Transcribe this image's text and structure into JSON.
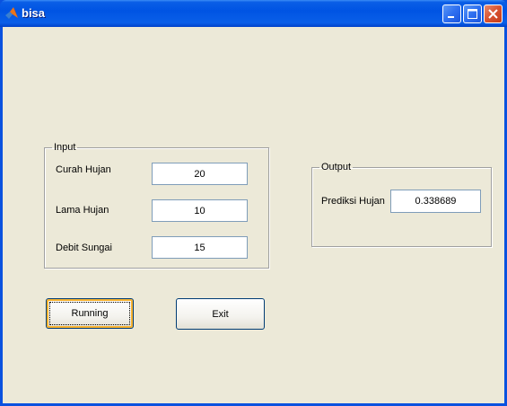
{
  "window": {
    "title": "bisa",
    "icon": "matlab-icon",
    "controls": [
      "minimize-icon",
      "maximize-icon",
      "close-icon"
    ]
  },
  "input_panel": {
    "legend": "Input",
    "fields": [
      {
        "label": "Curah Hujan",
        "value": "20"
      },
      {
        "label": "Lama Hujan",
        "value": "10"
      },
      {
        "label": "Debit Sungai",
        "value": "15"
      }
    ]
  },
  "output_panel": {
    "legend": "Output",
    "label": "Prediksi Hujan",
    "value": "0.338689"
  },
  "buttons": {
    "running": "Running",
    "exit": "Exit"
  },
  "colors": {
    "titlebar": "#0054e3",
    "background": "#ece9d8",
    "close_button": "#d8522f"
  }
}
